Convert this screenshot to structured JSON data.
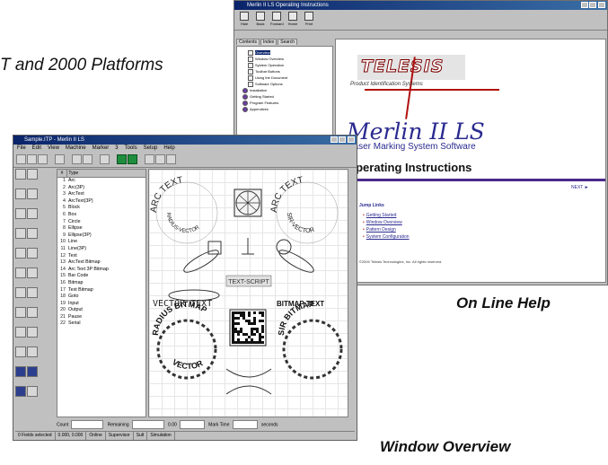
{
  "captions": {
    "platforms": "T and 2000 Platforms",
    "online_help": "On Line Help",
    "window_overview": "Window Overview"
  },
  "help_window": {
    "title": "Merlin II LS Operating Instructions",
    "toolbar": [
      "Hide",
      "Back",
      "Forward",
      "Home",
      "Print"
    ],
    "tabs": [
      "Contents",
      "Index",
      "Search"
    ],
    "tree": [
      {
        "label": "Overview",
        "kind": "page",
        "selected": true
      },
      {
        "label": "Window Overview",
        "kind": "page"
      },
      {
        "label": "System Operation",
        "kind": "page"
      },
      {
        "label": "Toolbar Buttons",
        "kind": "page"
      },
      {
        "label": "Using the Document",
        "kind": "page"
      },
      {
        "label": "Software Options",
        "kind": "page"
      },
      {
        "label": "Installation",
        "kind": "book"
      },
      {
        "label": "Getting Started",
        "kind": "book"
      },
      {
        "label": "Program Features",
        "kind": "book"
      },
      {
        "label": "Appendices",
        "kind": "book"
      }
    ],
    "brand_word": "TELESIS",
    "brand_tagline": "Product Identification Systems",
    "product_name": "Merlin II LS",
    "product_subtitle": "Laser Marking System Software",
    "heading": "Operating Instructions",
    "next_link": "NEXT ►",
    "nav_title": "Jump Links",
    "nav_links": [
      "Getting Started",
      "Window Overview",
      "Pattern Design",
      "System Configuration"
    ],
    "copyright": "©2000 Telesis Technologies, Inc. All rights reserved."
  },
  "main_window": {
    "title": "Sample.ITP - Merlin II LS",
    "menu": [
      "File",
      "Edit",
      "View",
      "Machine",
      "Marker",
      "3",
      "Tools",
      "Setup",
      "Help"
    ],
    "list_header": "Type",
    "objects": [
      "Arc",
      "Arc(3P)",
      "ArcText",
      "ArcText(3P)",
      "Block",
      "Box",
      "Circle",
      "Ellipse",
      "Ellipse(3P)",
      "Line",
      "Line(3P)",
      "Text",
      "ArcText Bitmap",
      "Arc Text 3P Bitmap",
      "Bar Code",
      "Bitmap",
      "Text Bitmap",
      "Goto",
      "Input",
      "Output",
      "Pause",
      "Serial"
    ],
    "canvas": {
      "arc_text_left": "ARC TEXT",
      "arc_text_left_inner": "RADIUS-VECTOR",
      "arc_text_right": "ARC TEXT",
      "arc_text_right_inner": "SIR-VECTOR",
      "vector_text": "VECTOR TEXT",
      "bitmap_text": "BITMAP TEXT",
      "radius_bitmap": "RADIUS BITMAP",
      "vector_arc": "VECTOR",
      "sir_bitmap": "SIR BITMAP",
      "stencil_text": "TEXT-SCRIPT"
    },
    "status_row": {
      "count_label": "Count",
      "remaining_label": "Remaining",
      "value": "0.00",
      "mark_time_label": "Mark Time",
      "seconds_label": "seconds"
    },
    "status_bar": [
      "0 Fields selected",
      "0.000, 0.000",
      "Online",
      "Supervisor",
      "Sult",
      "Simulation"
    ]
  }
}
